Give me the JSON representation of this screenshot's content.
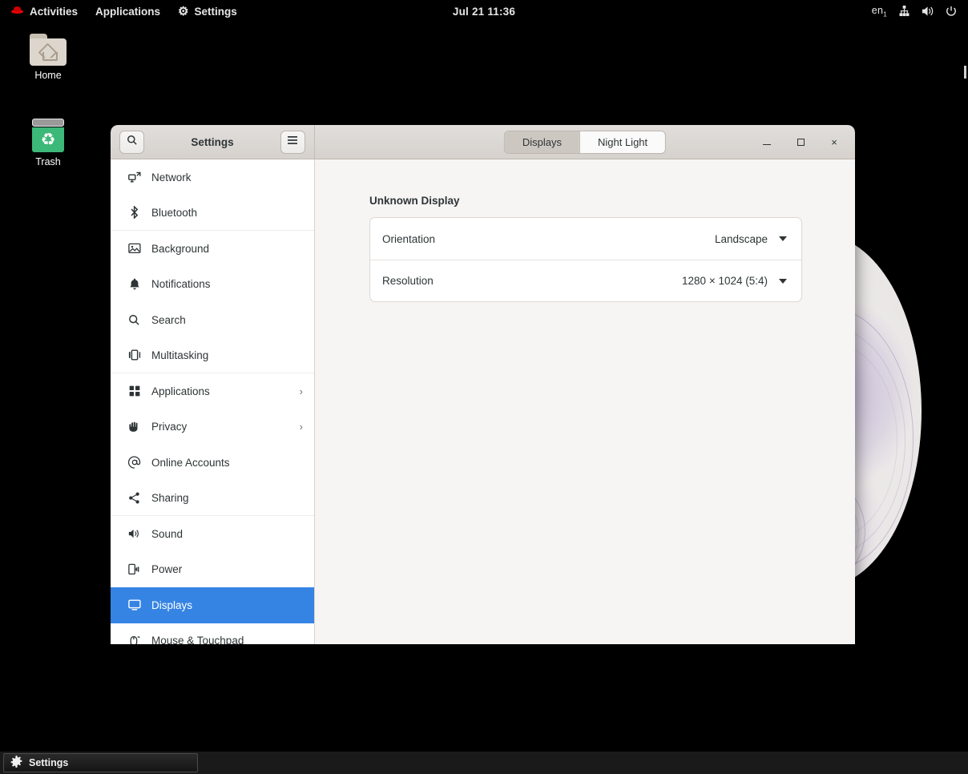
{
  "topbar": {
    "activities": "Activities",
    "applications": "Applications",
    "settings": "Settings",
    "clock": "Jul 21  11:36",
    "keyboard_layout": "en",
    "keyboard_sub": "1",
    "icons": [
      "fedora-icon",
      "gear-icon",
      "network-wired-icon",
      "volume-icon",
      "power-icon"
    ]
  },
  "desktop": {
    "icons": [
      {
        "label": "Home",
        "icon": "home-folder-icon"
      },
      {
        "label": "Trash",
        "icon": "trash-icon"
      }
    ]
  },
  "window": {
    "title": "Settings",
    "search_icon": "search-icon",
    "menu_icon": "hamburger-menu-icon",
    "tabs": [
      {
        "label": "Displays",
        "active": true
      },
      {
        "label": "Night Light",
        "active": false
      }
    ],
    "controls": {
      "minimize": "minimize-button",
      "maximize": "maximize-button",
      "close": "×"
    }
  },
  "sidebar": {
    "items": [
      {
        "label": "Network",
        "icon": "⧉",
        "chevron": "",
        "selected": false,
        "separator": false
      },
      {
        "label": "Bluetooth",
        "icon": "",
        "chevron": "",
        "selected": false,
        "separator": true
      },
      {
        "label": "Background",
        "icon": "🖾",
        "chevron": "",
        "selected": false,
        "separator": false
      },
      {
        "label": "Notifications",
        "icon": "🔔",
        "chevron": "",
        "selected": false,
        "separator": false
      },
      {
        "label": "Search",
        "icon": "⌕",
        "chevron": "",
        "selected": false,
        "separator": false
      },
      {
        "label": "Multitasking",
        "icon": "❐",
        "chevron": "",
        "selected": false,
        "separator": true
      },
      {
        "label": "Applications",
        "icon": "▦",
        "chevron": "›",
        "selected": false,
        "separator": false
      },
      {
        "label": "Privacy",
        "icon": "✋",
        "chevron": "›",
        "selected": false,
        "separator": false
      },
      {
        "label": "Online Accounts",
        "icon": "@",
        "chevron": "",
        "selected": false,
        "separator": false
      },
      {
        "label": "Sharing",
        "icon": "⤳",
        "chevron": "",
        "selected": false,
        "separator": true
      },
      {
        "label": "Sound",
        "icon": "🔊",
        "chevron": "",
        "selected": false,
        "separator": false
      },
      {
        "label": "Power",
        "icon": "🔌",
        "chevron": "",
        "selected": false,
        "separator": false
      },
      {
        "label": "Displays",
        "icon": "🖵",
        "chevron": "",
        "selected": true,
        "separator": false
      },
      {
        "label": "Mouse & Touchpad",
        "icon": "🖱",
        "chevron": "",
        "selected": false,
        "separator": false
      }
    ]
  },
  "content": {
    "section_title": "Unknown Display",
    "rows": [
      {
        "label": "Orientation",
        "value": "Landscape"
      },
      {
        "label": "Resolution",
        "value": "1280 × 1024 (5:4)"
      }
    ]
  },
  "taskbar": {
    "buttons": [
      {
        "label": "Settings",
        "icon": "gear-icon"
      }
    ]
  },
  "colors": {
    "accent": "#3584e4",
    "headerbar": "#d9d5d1",
    "content_bg": "#f6f5f4",
    "sidebar_bg": "#ffffff",
    "topbar_bg": "#000000"
  }
}
